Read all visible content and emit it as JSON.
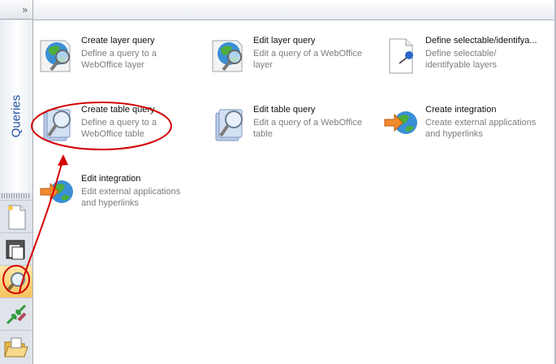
{
  "sidebar": {
    "collapse_label": "»",
    "panel_title": "Queries",
    "tools": [
      {
        "icon": "new-document-icon"
      },
      {
        "icon": "open-documents-icon"
      },
      {
        "icon": "search-icon",
        "active": true
      },
      {
        "icon": "move-arrows-icon"
      },
      {
        "icon": "open-folder-icon"
      }
    ]
  },
  "items": [
    {
      "title": "Create layer query",
      "desc": "Define a query to a WebOffice layer",
      "icon": "globe-map-search-icon"
    },
    {
      "title": "Edit layer query",
      "desc": "Edit a query of a WebOffice layer",
      "icon": "globe-map-search-icon"
    },
    {
      "title": "Define selectable/identifya...",
      "desc": "Define selectable/ identifyable layers",
      "icon": "document-pin-icon"
    },
    {
      "title": "Create table query",
      "desc": "Define a query to a WebOffice table",
      "icon": "table-search-icon"
    },
    {
      "title": "Edit table query",
      "desc": "Edit a query of a WebOffice table",
      "icon": "table-search-icon"
    },
    {
      "title": "Create integration",
      "desc": "Create external applications and hyperlinks",
      "icon": "globe-arrow-icon"
    },
    {
      "title": "Edit integration",
      "desc": "Edit external applications and hyperlinks",
      "icon": "globe-arrow-icon"
    }
  ],
  "colors": {
    "annotation": "#d40000",
    "panel_title": "#1f4fa3"
  }
}
